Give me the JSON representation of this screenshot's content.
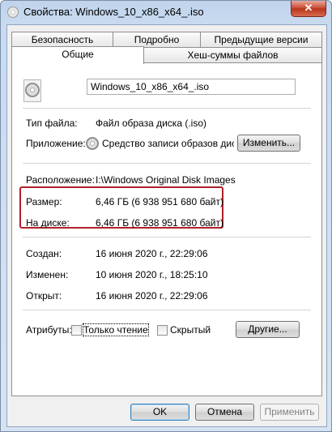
{
  "window": {
    "title": "Свойства: Windows_10_x86_x64_.iso",
    "close_label": "✕"
  },
  "tabs": {
    "row1": [
      "Безопасность",
      "Подробно",
      "Предыдущие версии"
    ],
    "row2": [
      "Общие",
      "Хеш-суммы файлов"
    ],
    "active": "Общие"
  },
  "general": {
    "file_name": "Windows_10_x86_x64_.iso",
    "type_label": "Тип файла:",
    "type_value": "Файл образа диска (.iso)",
    "app_label": "Приложение:",
    "app_value": "Средство записи образов диско",
    "change_button": "Изменить...",
    "location_label": "Расположение:",
    "location_value": "I:\\Windows Original Disk Images",
    "size_label": "Размер:",
    "size_value": "6,46 ГБ (6 938 951 680 байт)",
    "disk_label": "На диске:",
    "disk_value": "6,46 ГБ (6 938 951 680 байт)",
    "created_label": "Создан:",
    "created_value": "16 июня 2020 г., 22:29:06",
    "modified_label": "Изменен:",
    "modified_value": "10 июня 2020 г., 18:25:10",
    "opened_label": "Открыт:",
    "opened_value": "16 июня 2020 г., 22:29:06",
    "attributes_label": "Атрибуты:",
    "readonly_label": "Только чтение",
    "readonly_checked": false,
    "hidden_label": "Скрытый",
    "hidden_checked": false,
    "other_button": "Другие..."
  },
  "buttons": {
    "ok": "OK",
    "cancel": "Отмена",
    "apply": "Применить"
  },
  "colors": {
    "highlight_border": "#b0202a"
  }
}
